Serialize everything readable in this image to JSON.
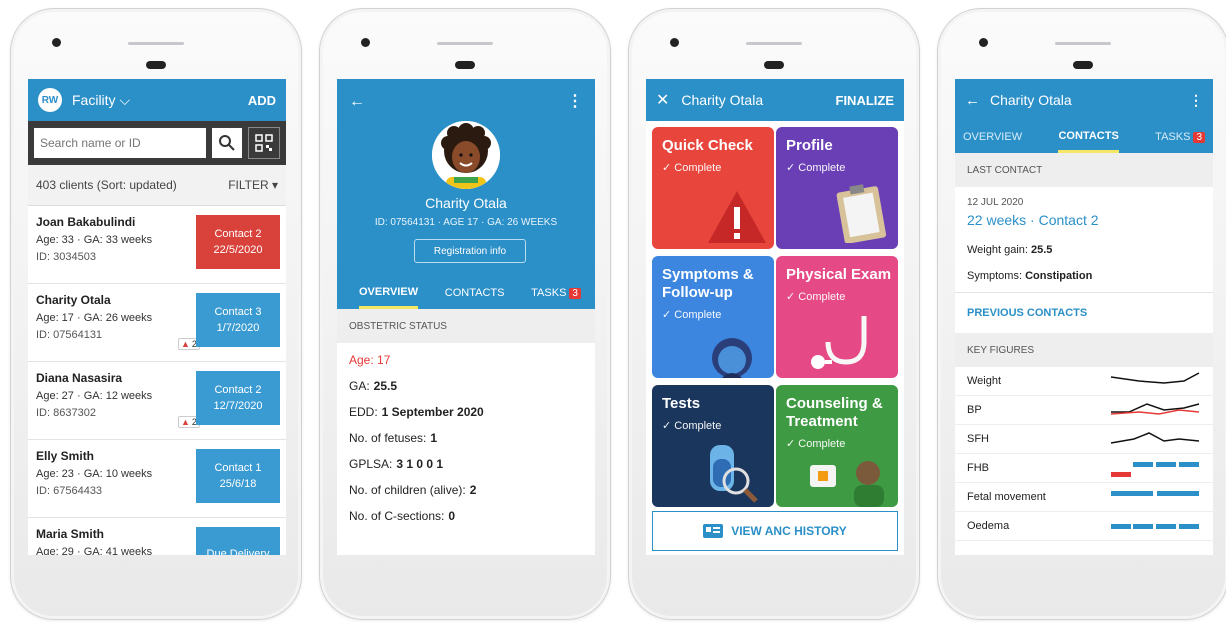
{
  "colors": {
    "primary": "#2b8fc8",
    "red": "#d9423b",
    "contact_blue": "#3a9bd2",
    "quick_check": "#e8453c",
    "profile": "#6a3fb5",
    "symptoms": "#3d86e0",
    "physical_exam": "#e64a86",
    "tests": "#1a365d",
    "counseling": "#3f9b43"
  },
  "screen1": {
    "avatar": "RW",
    "facility": "Facility",
    "add": "ADD",
    "search_placeholder": "Search name or ID",
    "count": "403 clients (Sort: updated)",
    "filter": "FILTER",
    "clients": [
      {
        "name": "Joan Bakabulindi",
        "age": "Age: 33 · GA: 33 weeks",
        "id": "ID: 3034503",
        "c1": "Contact 2",
        "c2": "22/5/2020",
        "warn": ""
      },
      {
        "name": "Charity Otala",
        "age": "Age: 17 · GA: 26 weeks",
        "id": "ID: 07564131",
        "c1": "Contact 3",
        "c2": "1/7/2020",
        "warn": "2"
      },
      {
        "name": "Diana Nasasira",
        "age": "Age: 27 · GA: 12 weeks",
        "id": "ID: 8637302",
        "c1": "Contact 2",
        "c2": "12/7/2020",
        "warn": "2"
      },
      {
        "name": "Elly Smith",
        "age": "Age: 23 · GA: 10 weeks",
        "id": "ID: 67564433",
        "c1": "Contact 1",
        "c2": "25/6/18",
        "warn": ""
      },
      {
        "name": "Maria Smith",
        "age": "Age: 29 · GA: 41 weeks",
        "id": "",
        "c1": "Due Delivery",
        "c2": "",
        "warn": ""
      }
    ]
  },
  "screen2": {
    "name": "Charity Otala",
    "meta": "ID: 07564131 · AGE 17 · GA: 26 WEEKS",
    "reg": "Registration info",
    "tabs": {
      "overview": "OVERVIEW",
      "contacts": "CONTACTS",
      "tasks": "TASKS",
      "tasks_count": "3"
    },
    "section": "OBSTETRIC STATUS",
    "age": "Age: 17",
    "rows": [
      {
        "k": "GA:",
        "v": "25.5"
      },
      {
        "k": "EDD:",
        "v": "1 September 2020"
      },
      {
        "k": "No. of fetuses:",
        "v": "1"
      },
      {
        "k": "GPLSA:",
        "v": "3 1 0 0 1"
      },
      {
        "k": "No. of children (alive):",
        "v": "2"
      },
      {
        "k": "No. of C-sections:",
        "v": "0"
      }
    ]
  },
  "screen3": {
    "title": "Charity Otala",
    "finalize": "FINALIZE",
    "tiles": [
      {
        "title": "Quick Check",
        "status": "✓ Complete"
      },
      {
        "title": "Profile",
        "status": "✓ Complete"
      },
      {
        "title": "Symptoms & Follow-up",
        "status": "✓ Complete"
      },
      {
        "title": "Physical Exam",
        "status": "✓ Complete"
      },
      {
        "title": "Tests",
        "status": "✓ Complete"
      },
      {
        "title": "Counseling & Treatment",
        "status": "✓ Complete"
      }
    ],
    "anc": "VIEW ANC HISTORY"
  },
  "screen4": {
    "title": "Charity Otala",
    "tabs": {
      "overview": "OVERVIEW",
      "contacts": "CONTACTS",
      "tasks": "TASKS",
      "tasks_count": "3"
    },
    "last_contact": "LAST CONTACT",
    "date": "12 JUL 2020",
    "contact": "22 weeks · Contact 2",
    "weight_k": "Weight gain:",
    "weight_v": "25.5",
    "symptoms_k": "Symptoms:",
    "symptoms_v": "Constipation",
    "previous": "PREVIOUS CONTACTS",
    "key_figures": "KEY FIGURES",
    "figures": [
      "Weight",
      "BP",
      "SFH",
      "FHB",
      "Fetal movement",
      "Oedema"
    ]
  }
}
